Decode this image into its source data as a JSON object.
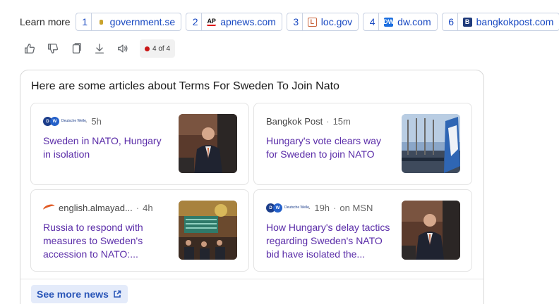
{
  "learn_more": {
    "label": "Learn more",
    "sources": [
      {
        "num": "1",
        "domain": "government.se",
        "icon": "sweden-gov-icon"
      },
      {
        "num": "2",
        "domain": "apnews.com",
        "icon": "ap-icon",
        "glyph": "AP"
      },
      {
        "num": "3",
        "domain": "loc.gov",
        "icon": "loc-icon",
        "glyph": "L"
      },
      {
        "num": "4",
        "domain": "dw.com",
        "icon": "dw-icon",
        "glyph": "DW"
      },
      {
        "num": "6",
        "domain": "bangkokpost.com",
        "icon": "bangkok-post-icon",
        "glyph": "B"
      }
    ]
  },
  "actions": {
    "icons": [
      "thumbs-up-icon",
      "thumbs-down-icon",
      "copy-icon",
      "download-icon",
      "speaker-icon"
    ],
    "counter": "4 of 4"
  },
  "news": {
    "title": "Here are some articles about Terms For Sweden To Join Nato",
    "cards": [
      {
        "source": "",
        "logo": "dw-logo",
        "logo_text": "Deutsche Welle",
        "age": "5h",
        "extra": "",
        "headline": "Sweden in NATO, Hungary in isolation"
      },
      {
        "source": "Bangkok Post",
        "logo": "",
        "age": "15m",
        "extra": "",
        "headline": "Hungary's vote clears way for Sweden to join NATO"
      },
      {
        "source": "english.almayad...",
        "logo": "almayadeen-logo",
        "age": "4h",
        "extra": "",
        "headline": "Russia to respond with measures to Sweden's accession to NATO:..."
      },
      {
        "source": "",
        "logo": "dw-logo",
        "logo_text": "Deutsche Welle",
        "age": "19h",
        "extra": "on MSN",
        "headline": "How Hungary's delay tactics regarding Sweden's NATO bid have isolated the..."
      }
    ],
    "see_more": "See more news"
  },
  "colors": {
    "link_blue": "#1a4ac2",
    "headline_purple": "#5a2ca8",
    "see_more_bg": "#e4ebfa",
    "counter_dot": "#c91515"
  }
}
